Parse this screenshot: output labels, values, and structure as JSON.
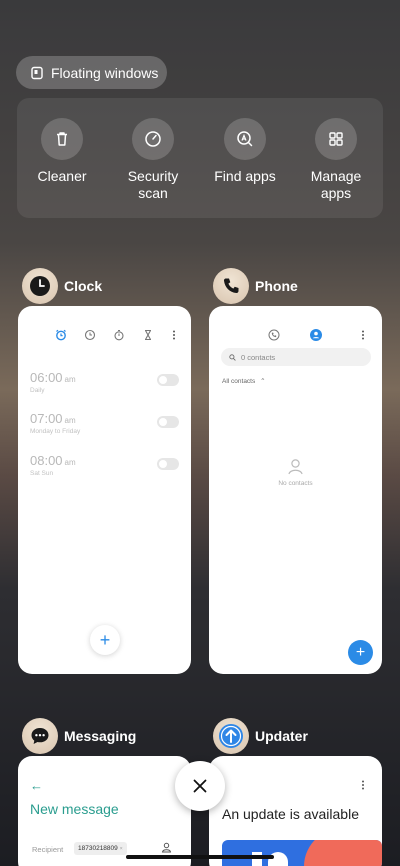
{
  "floating_windows": {
    "label": "Floating windows"
  },
  "tools": [
    {
      "label": "Cleaner",
      "icon": "trash-icon"
    },
    {
      "label": "Security\nscan",
      "line1": "Security",
      "line2": "scan",
      "icon": "shield-icon"
    },
    {
      "label": "Find apps",
      "icon": "find-apps-icon"
    },
    {
      "label": "Manage\napps",
      "line1": "Manage",
      "line2": "apps",
      "icon": "grid-icon"
    }
  ],
  "apps": {
    "clock": {
      "name": "Clock",
      "alarms": [
        {
          "time": "06:00",
          "ampm": "am",
          "sub": "Daily"
        },
        {
          "time": "07:00",
          "ampm": "am",
          "sub": "Monday to Friday"
        },
        {
          "time": "08:00",
          "ampm": "am",
          "sub": "Sat Sun"
        }
      ]
    },
    "phone": {
      "name": "Phone",
      "search_placeholder": "0 contacts",
      "filter": "All contacts",
      "empty": "No contacts"
    },
    "messaging": {
      "name": "Messaging",
      "title": "New message",
      "recipient_label": "Recipient",
      "recipient_value": "18730218809"
    },
    "updater": {
      "name": "Updater",
      "headline": "An update is available"
    }
  },
  "colors": {
    "accent_blue": "#2b8be6",
    "messaging_green": "#2a9d8f",
    "updater_blue": "#2f6fe0",
    "updater_coral": "#f06a5a"
  }
}
